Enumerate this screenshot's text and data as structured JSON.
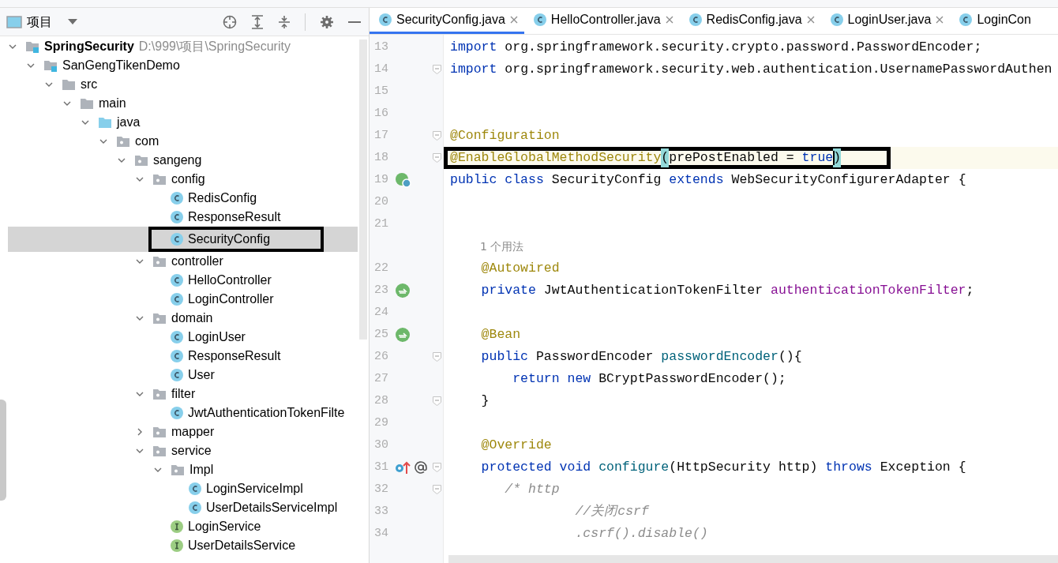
{
  "project_panel": {
    "title": "项目",
    "tree": [
      {
        "label": "SpringSecurity",
        "path": "D:\\999\\项目\\SpringSecurity",
        "kind": "project",
        "expanded": true,
        "selected": false,
        "children": [
          {
            "label": "SanGengTikenDemo",
            "kind": "module",
            "expanded": true,
            "selected": false,
            "children": [
              {
                "label": "src",
                "kind": "folder",
                "expanded": true,
                "selected": false,
                "children": [
                  {
                    "label": "main",
                    "kind": "folder",
                    "expanded": true,
                    "selected": false,
                    "children": [
                      {
                        "label": "java",
                        "kind": "source",
                        "expanded": true,
                        "selected": false,
                        "children": [
                          {
                            "label": "com",
                            "kind": "package",
                            "expanded": true,
                            "selected": false,
                            "children": [
                              {
                                "label": "sangeng",
                                "kind": "package",
                                "expanded": true,
                                "selected": false,
                                "children": [
                                  {
                                    "label": "config",
                                    "kind": "package",
                                    "expanded": true,
                                    "selected": false,
                                    "children": [
                                      {
                                        "label": "RedisConfig",
                                        "kind": "class",
                                        "selected": false
                                      },
                                      {
                                        "label": "ResponseResult",
                                        "kind": "class",
                                        "selected": false
                                      },
                                      {
                                        "label": "SecurityConfig",
                                        "kind": "class",
                                        "selected": true,
                                        "annotated": true
                                      }
                                    ]
                                  },
                                  {
                                    "label": "controller",
                                    "kind": "package",
                                    "expanded": true,
                                    "selected": false,
                                    "children": [
                                      {
                                        "label": "HelloController",
                                        "kind": "class",
                                        "selected": false
                                      },
                                      {
                                        "label": "LoginController",
                                        "kind": "class",
                                        "selected": false
                                      }
                                    ]
                                  },
                                  {
                                    "label": "domain",
                                    "kind": "package",
                                    "expanded": true,
                                    "selected": false,
                                    "children": [
                                      {
                                        "label": "LoginUser",
                                        "kind": "class",
                                        "selected": false
                                      },
                                      {
                                        "label": "ResponseResult",
                                        "kind": "class",
                                        "selected": false
                                      },
                                      {
                                        "label": "User",
                                        "kind": "class",
                                        "selected": false
                                      }
                                    ]
                                  },
                                  {
                                    "label": "filter",
                                    "kind": "package",
                                    "expanded": true,
                                    "selected": false,
                                    "children": [
                                      {
                                        "label": "JwtAuthenticationTokenFilte",
                                        "kind": "class",
                                        "selected": false
                                      }
                                    ]
                                  },
                                  {
                                    "label": "mapper",
                                    "kind": "package",
                                    "expanded": false,
                                    "selected": false
                                  },
                                  {
                                    "label": "service",
                                    "kind": "package",
                                    "expanded": true,
                                    "selected": false,
                                    "children": [
                                      {
                                        "label": "Impl",
                                        "kind": "package",
                                        "expanded": true,
                                        "selected": false,
                                        "children": [
                                          {
                                            "label": "LoginServiceImpl",
                                            "kind": "class",
                                            "selected": false
                                          },
                                          {
                                            "label": "UserDetailsServiceImpl",
                                            "kind": "class",
                                            "selected": false
                                          }
                                        ]
                                      },
                                      {
                                        "label": "LoginService",
                                        "kind": "interface",
                                        "selected": false
                                      },
                                      {
                                        "label": "UserDetailsService",
                                        "kind": "interface",
                                        "selected": false
                                      }
                                    ]
                                  }
                                ]
                              }
                            ]
                          }
                        ]
                      }
                    ]
                  }
                ]
              }
            ]
          }
        ]
      }
    ]
  },
  "editor": {
    "tabs": [
      {
        "label": "SecurityConfig.java",
        "selected": true,
        "closable": true
      },
      {
        "label": "HelloController.java",
        "selected": false,
        "closable": true
      },
      {
        "label": "RedisConfig.java",
        "selected": false,
        "closable": true
      },
      {
        "label": "LoginUser.java",
        "selected": false,
        "closable": true
      },
      {
        "label": "LoginCon",
        "selected": false,
        "closable": false
      }
    ],
    "lines": [
      {
        "number": "13",
        "tokens": [
          {
            "text": "import",
            "kind": "keyword"
          },
          {
            "text": " org.springframework.security.crypto.password.PasswordEncoder;",
            "kind": "plain"
          }
        ]
      },
      {
        "number": "14",
        "fold": true,
        "tokens": [
          {
            "text": "import",
            "kind": "keyword"
          },
          {
            "text": " org.springframework.security.web.authentication.UsernamePasswordAuthen",
            "kind": "plain"
          }
        ]
      },
      {
        "number": "15"
      },
      {
        "number": "16"
      },
      {
        "number": "17",
        "fold": true,
        "tokens": [
          {
            "text": "@Configuration",
            "kind": "annotation"
          }
        ]
      },
      {
        "number": "18",
        "fold": true,
        "current": true,
        "annotated": true,
        "tokens": [
          {
            "text": "@EnableGlobalMethodSecurity",
            "kind": "annotation"
          },
          {
            "text": "(",
            "kind": "brace"
          },
          {
            "text": "prePostEnabled = ",
            "kind": "plain"
          },
          {
            "text": "true",
            "kind": "keyword"
          },
          {
            "text": ")",
            "kind": "brace"
          }
        ]
      },
      {
        "number": "19",
        "gutter_marker": {
          "kind": "bean"
        },
        "tokens": [
          {
            "text": "public class",
            "kind": "keyword"
          },
          {
            "text": " SecurityConfig ",
            "kind": "plain"
          },
          {
            "text": "extends",
            "kind": "keyword"
          },
          {
            "text": " WebSecurityConfigurerAdapter {",
            "kind": "plain"
          }
        ]
      },
      {
        "number": "20"
      },
      {
        "number": "21"
      },
      {
        "hint": "1 个用法"
      },
      {
        "number": "22",
        "tokens": [
          {
            "text": "    @Autowired",
            "kind": "annotation"
          }
        ]
      },
      {
        "number": "23",
        "gutter_marker": {
          "kind": "autowired"
        },
        "tokens": [
          {
            "text": "    private",
            "kind": "keyword"
          },
          {
            "text": " JwtAuthenticationTokenFilter ",
            "kind": "plain"
          },
          {
            "text": "authenticationTokenFilter",
            "kind": "field"
          },
          {
            "text": ";",
            "kind": "plain"
          }
        ]
      },
      {
        "number": "24"
      },
      {
        "number": "25",
        "gutter_marker": {
          "kind": "autowired"
        },
        "tokens": [
          {
            "text": "    @Bean",
            "kind": "annotation"
          }
        ]
      },
      {
        "number": "26",
        "fold": true,
        "tokens": [
          {
            "text": "    public",
            "kind": "keyword"
          },
          {
            "text": " PasswordEncoder ",
            "kind": "plain"
          },
          {
            "text": "passwordEncoder",
            "kind": "method"
          },
          {
            "text": "(){",
            "kind": "plain"
          }
        ]
      },
      {
        "number": "27",
        "tokens": [
          {
            "text": "        return new",
            "kind": "keyword"
          },
          {
            "text": " BCryptPasswordEncoder();",
            "kind": "plain"
          }
        ]
      },
      {
        "number": "28",
        "fold": true,
        "tokens": [
          {
            "text": "    }",
            "kind": "plain"
          }
        ]
      },
      {
        "number": "29"
      },
      {
        "number": "30",
        "tokens": [
          {
            "text": "    @Override",
            "kind": "annotation"
          }
        ]
      },
      {
        "number": "31",
        "gutter_marker": {
          "kind": "override"
        },
        "fold": true,
        "tokens": [
          {
            "text": "    protected void ",
            "kind": "keyword"
          },
          {
            "text": "configure",
            "kind": "method"
          },
          {
            "text": "(HttpSecurity http) ",
            "kind": "plain"
          },
          {
            "text": "throws",
            "kind": "keyword"
          },
          {
            "text": " Exception {",
            "kind": "plain"
          }
        ]
      },
      {
        "number": "32",
        "fold": true,
        "tokens": [
          {
            "text": "       /* http",
            "kind": "comment"
          }
        ]
      },
      {
        "number": "33",
        "tokens": [
          {
            "text": "                //关闭csrf",
            "kind": "comment"
          }
        ]
      },
      {
        "number": "34",
        "tokens": [
          {
            "text": "                .csrf().disable()",
            "kind": "comment"
          }
        ]
      }
    ]
  }
}
